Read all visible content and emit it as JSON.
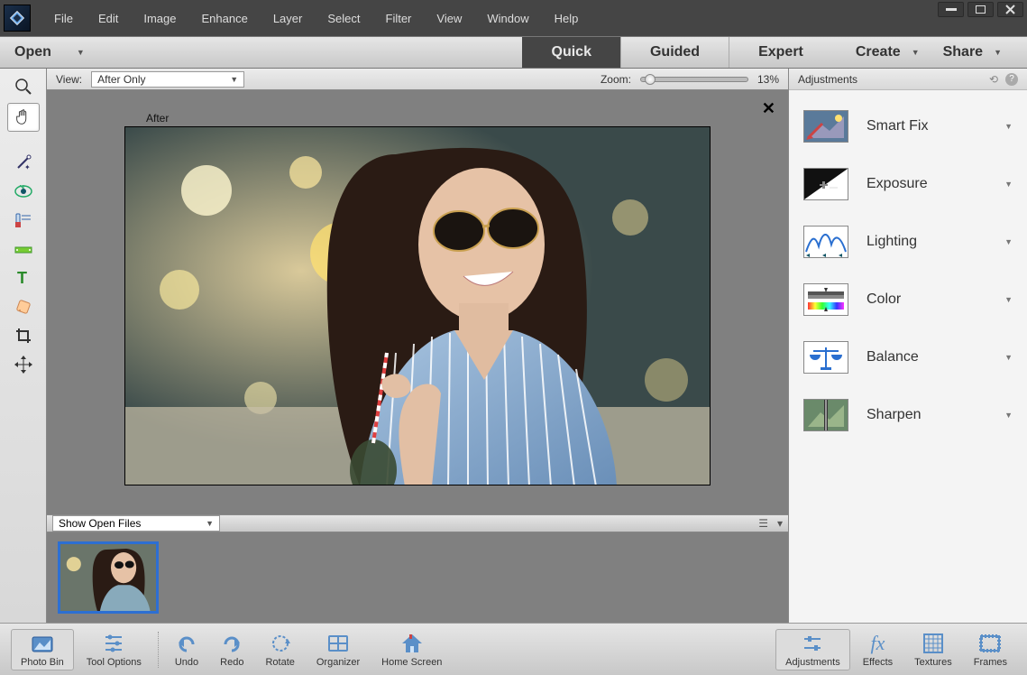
{
  "menu": {
    "items": [
      "File",
      "Edit",
      "Image",
      "Enhance",
      "Layer",
      "Select",
      "Filter",
      "View",
      "Window",
      "Help"
    ]
  },
  "workspace": {
    "open_label": "Open",
    "tabs": [
      {
        "label": "Quick",
        "active": true
      },
      {
        "label": "Guided",
        "active": false
      },
      {
        "label": "Expert",
        "active": false
      }
    ],
    "create_label": "Create",
    "share_label": "Share"
  },
  "options": {
    "view_label": "View:",
    "view_value": "After Only",
    "zoom_label": "Zoom:",
    "zoom_value": "13%"
  },
  "canvas": {
    "after_label": "After"
  },
  "bin_bar": {
    "dropdown": "Show Open Files"
  },
  "right_panel": {
    "title": "Adjustments",
    "items": [
      {
        "label": "Smart Fix",
        "icon": "smartfix"
      },
      {
        "label": "Exposure",
        "icon": "exposure"
      },
      {
        "label": "Lighting",
        "icon": "lighting"
      },
      {
        "label": "Color",
        "icon": "color"
      },
      {
        "label": "Balance",
        "icon": "balance"
      },
      {
        "label": "Sharpen",
        "icon": "sharpen"
      }
    ]
  },
  "taskbar": {
    "left": [
      {
        "label": "Photo Bin",
        "icon": "photo-bin",
        "active": true
      },
      {
        "label": "Tool Options",
        "icon": "tool-options"
      }
    ],
    "mid": [
      {
        "label": "Undo",
        "icon": "undo"
      },
      {
        "label": "Redo",
        "icon": "redo"
      },
      {
        "label": "Rotate",
        "icon": "rotate"
      },
      {
        "label": "Organizer",
        "icon": "organizer"
      },
      {
        "label": "Home Screen",
        "icon": "home"
      }
    ],
    "right": [
      {
        "label": "Adjustments",
        "icon": "adjust",
        "active": true
      },
      {
        "label": "Effects",
        "icon": "fx"
      },
      {
        "label": "Textures",
        "icon": "textures"
      },
      {
        "label": "Frames",
        "icon": "frames"
      }
    ]
  },
  "tools": [
    "zoom",
    "hand",
    "wand",
    "redeye",
    "whiten",
    "straighten",
    "text",
    "spot",
    "crop",
    "move"
  ]
}
